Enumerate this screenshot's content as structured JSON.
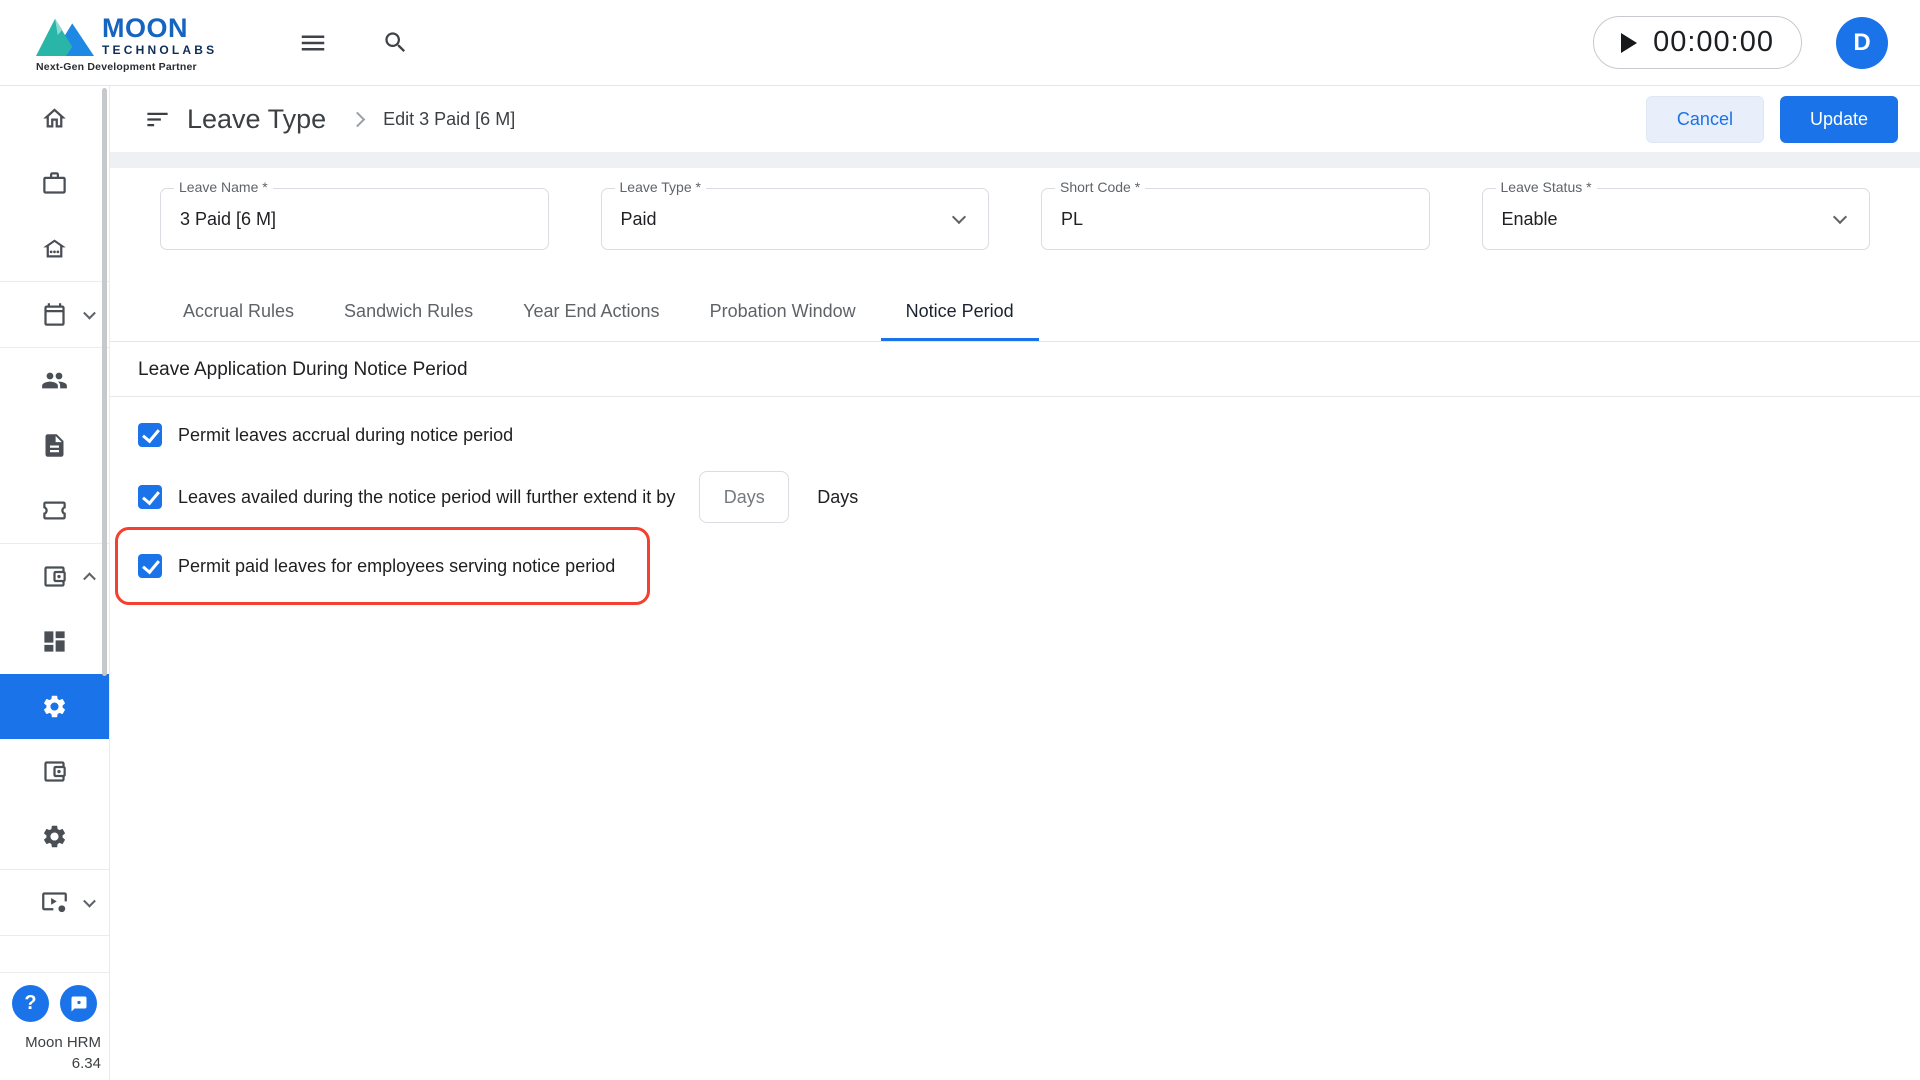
{
  "colors": {
    "accent": "#1a73e8",
    "highlight_red": "#f3402f",
    "logo_teal": "#29b5a8",
    "logo_blue": "#1e88e5"
  },
  "topbar": {
    "logo": {
      "name": "MOON",
      "sub": "TECHNOLABS",
      "tagline": "Next-Gen Development Partner"
    },
    "icons": [
      "menu-icon",
      "search-icon",
      "play-icon"
    ],
    "timer": {
      "value": "00:00:00"
    },
    "avatar": {
      "initial": "D"
    }
  },
  "sidebar": {
    "icons": [
      "home",
      "work-briefcase",
      "other-house",
      "calendar",
      "groups",
      "document",
      "ticket",
      "wallet-payroll",
      "dashboard",
      "settings",
      "wallet",
      "settings-alt",
      "video-settings"
    ],
    "active_icon": "settings",
    "footer": {
      "app_name": "Moon HRM",
      "version": "6.34"
    }
  },
  "page": {
    "title": "Leave Type",
    "breadcrumb": "Edit 3 Paid [6 M]",
    "actions": {
      "cancel": "Cancel",
      "update": "Update"
    }
  },
  "form": {
    "fields": [
      {
        "label": "Leave Name *",
        "value": "3 Paid [6 M]",
        "type": "text"
      },
      {
        "label": "Leave Type *",
        "value": "Paid",
        "type": "select"
      },
      {
        "label": "Short Code *",
        "value": "PL",
        "type": "text"
      },
      {
        "label": "Leave Status *",
        "value": "Enable",
        "type": "select"
      }
    ]
  },
  "tabs": {
    "items": [
      "Accrual Rules",
      "Sandwich Rules",
      "Year End Actions",
      "Probation Window",
      "Notice Period"
    ],
    "active": "Notice Period"
  },
  "notice": {
    "section_title": "Leave Application During Notice Period",
    "checkboxes": [
      {
        "label": "Permit leaves accrual during notice period",
        "checked": true
      },
      {
        "label": "Leaves availed during the notice period will further extend it by",
        "checked": true,
        "input_placeholder": "Days",
        "suffix_label": "Days"
      },
      {
        "label": "Permit paid leaves for employees serving notice period",
        "checked": true,
        "highlighted": true
      }
    ]
  }
}
